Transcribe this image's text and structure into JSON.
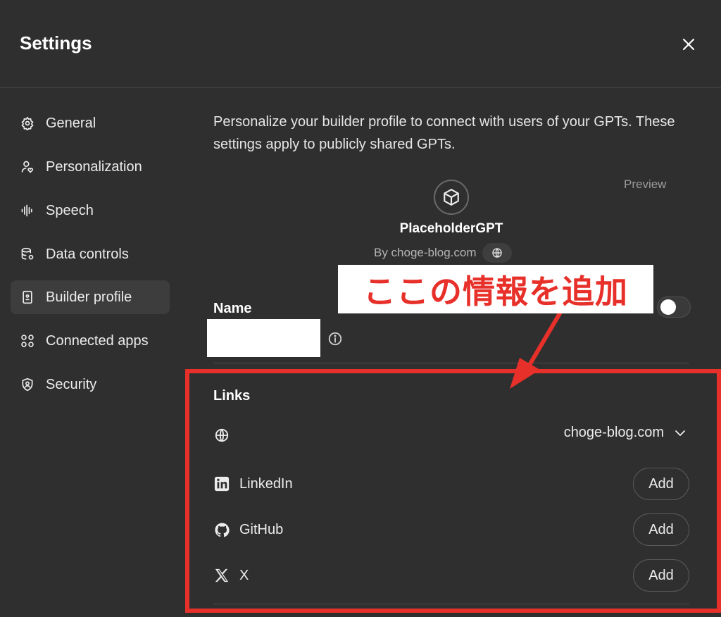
{
  "window": {
    "title": "Settings",
    "close_icon": "close-icon"
  },
  "sidebar": {
    "items": [
      {
        "label": "General",
        "icon": "gear-icon",
        "active": false
      },
      {
        "label": "Personalization",
        "icon": "person-heart-icon",
        "active": false
      },
      {
        "label": "Speech",
        "icon": "waveform-icon",
        "active": false
      },
      {
        "label": "Data controls",
        "icon": "database-gear-icon",
        "active": false
      },
      {
        "label": "Builder profile",
        "icon": "id-card-icon",
        "active": true
      },
      {
        "label": "Connected apps",
        "icon": "grid-dots-icon",
        "active": false
      },
      {
        "label": "Security",
        "icon": "shield-person-icon",
        "active": false
      }
    ]
  },
  "main": {
    "description": "Personalize your builder profile to connect with users of your GPTs. These settings apply to publicly shared GPTs.",
    "preview": {
      "label": "Preview",
      "avatar_icon": "cube-icon",
      "gpt_name": "PlaceholderGPT",
      "by_line": "By choge-blog.com"
    },
    "name": {
      "label": "Name",
      "toggle_on": false
    },
    "links": {
      "label": "Links",
      "website": {
        "domain": "choge-blog.com"
      },
      "items": [
        {
          "label": "LinkedIn",
          "icon": "linkedin-icon",
          "button": "Add"
        },
        {
          "label": "GitHub",
          "icon": "github-icon",
          "button": "Add"
        },
        {
          "label": "X",
          "icon": "x-icon",
          "button": "Add"
        }
      ]
    }
  },
  "annotation": {
    "text": "ここの情報を追加",
    "color": "#e8302a"
  }
}
